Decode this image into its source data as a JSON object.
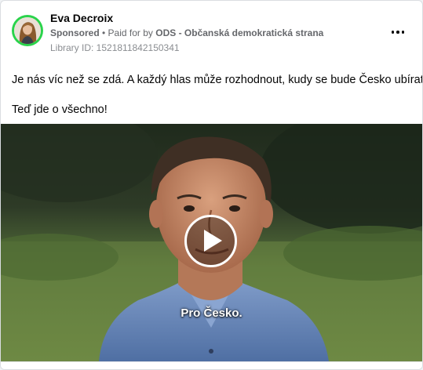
{
  "post": {
    "author_name": "Eva Decroix",
    "sponsored_label": "Sponsored",
    "separator": " • ",
    "paid_for_prefix": "Paid for by ",
    "paid_for_name": "ODS - Občanská demokratická strana",
    "library_id": "Library ID: 1521811842150341",
    "body_line_1": "Je nás víc než se zdá. A každý hlas může rozhodnout, kudy se bude Česko ubírat.",
    "body_line_2": "Teď jde o všechno!"
  },
  "video": {
    "caption": "Pro Česko.",
    "play_icon": "play-icon"
  },
  "colors": {
    "avatar_ring": "#2ad34b",
    "text_primary": "#050505",
    "text_secondary": "#65676b"
  }
}
